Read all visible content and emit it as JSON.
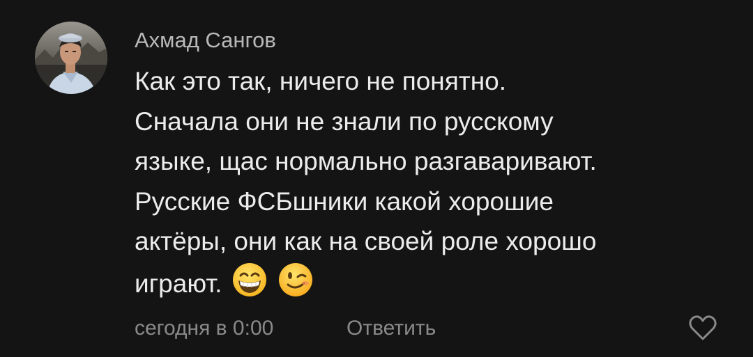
{
  "comment": {
    "author": "Ахмад Сангов",
    "text_lines": [
      "Как это так, ничего не понятно.",
      "Сначала они не знали по русскому",
      "языке, щас нормально разгаваривают.",
      "Русские ФСБшники какой хорошие",
      "актёры, они как на своей роле хорошо",
      "играют."
    ],
    "emojis": [
      "grinning-face-emoji",
      "winking-face-emoji"
    ],
    "timestamp": "сегодня в 0:00",
    "reply_label": "Ответить",
    "like_icon": "heart-outline-icon"
  },
  "colors": {
    "background": "#141414",
    "author": "#b9b9b9",
    "text": "#ececec",
    "meta": "#8a8a8a"
  }
}
